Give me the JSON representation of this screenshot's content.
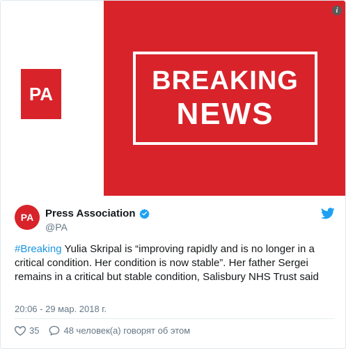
{
  "media": {
    "logo_text": "PA",
    "headline_line1": "BREAKING",
    "headline_line2": "NEWS",
    "info_glyph": "i",
    "colors": {
      "brand_red": "#d8232a",
      "white": "#ffffff"
    }
  },
  "author": {
    "avatar_text": "PA",
    "name": "Press Association",
    "handle": "@PA",
    "verified_icon": "verified-badge-icon",
    "platform_icon": "twitter-bird-icon"
  },
  "tweet": {
    "hashtag": "#Breaking",
    "text": " Yulia Skripal is “improving rapidly and is no longer in a critical condition. Her condition is now stable”. Her father Sergei remains in a critical but stable condition, Salisbury NHS Trust said",
    "timestamp": "20:06 - 29 мар. 2018 г."
  },
  "actions": {
    "like_count": "35",
    "like_icon": "heart-icon",
    "comment_icon": "speech-bubble-icon",
    "talking_text": "48 человек(а) говорят об этом"
  },
  "colors": {
    "link_blue": "#1b95e0",
    "muted_gray": "#657786",
    "text": "#14171a"
  }
}
